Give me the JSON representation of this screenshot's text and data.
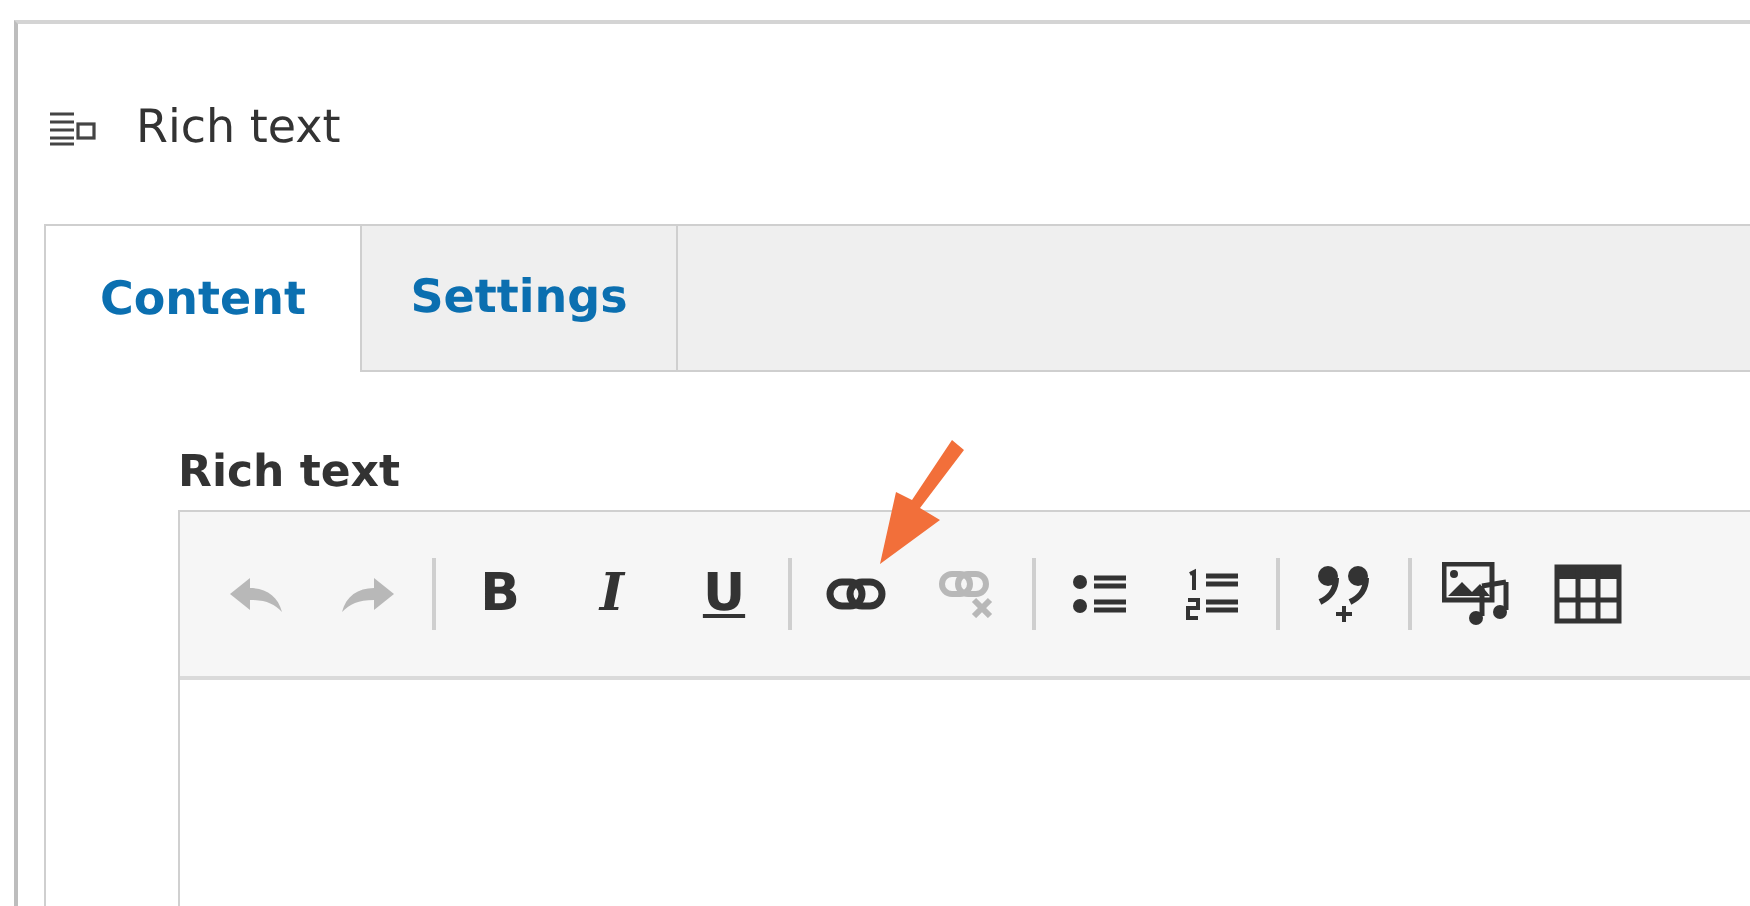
{
  "block": {
    "title": "Rich text"
  },
  "tabs": [
    {
      "label": "Content",
      "selected": true
    },
    {
      "label": "Settings",
      "selected": false
    }
  ],
  "field": {
    "label": "Rich text"
  },
  "toolbar": [
    [
      {
        "kind": "undo",
        "disabled": true
      },
      {
        "kind": "redo",
        "disabled": true
      }
    ],
    [
      {
        "kind": "bold",
        "label": "B",
        "disabled": false
      },
      {
        "kind": "italic",
        "label": "I",
        "disabled": false
      },
      {
        "kind": "underline",
        "label": "U",
        "disabled": false
      }
    ],
    [
      {
        "kind": "link",
        "disabled": false,
        "highlighted": true
      },
      {
        "kind": "unlink",
        "disabled": true
      }
    ],
    [
      {
        "kind": "bullets",
        "disabled": false
      },
      {
        "kind": "numbers",
        "disabled": false
      }
    ],
    [
      {
        "kind": "quote",
        "disabled": false
      }
    ],
    [
      {
        "kind": "media",
        "disabled": false
      },
      {
        "kind": "table",
        "disabled": false
      }
    ]
  ]
}
